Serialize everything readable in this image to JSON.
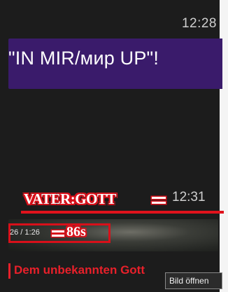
{
  "messages": [
    {
      "time": "12:28",
      "text": "\"IN MIR/мир UP\"!"
    },
    {
      "time": "12:31"
    }
  ],
  "annotation": {
    "label": "VATER:GOTT"
  },
  "video": {
    "duration": "26 / 1:26",
    "seconds_label": "86s"
  },
  "caption": "Dem unbekannten Gott",
  "tooltip": "Bild öffnen",
  "colors": {
    "bubble": "#3a1b6b",
    "accent_red": "#d8101a",
    "background": "#1c1c1c"
  }
}
